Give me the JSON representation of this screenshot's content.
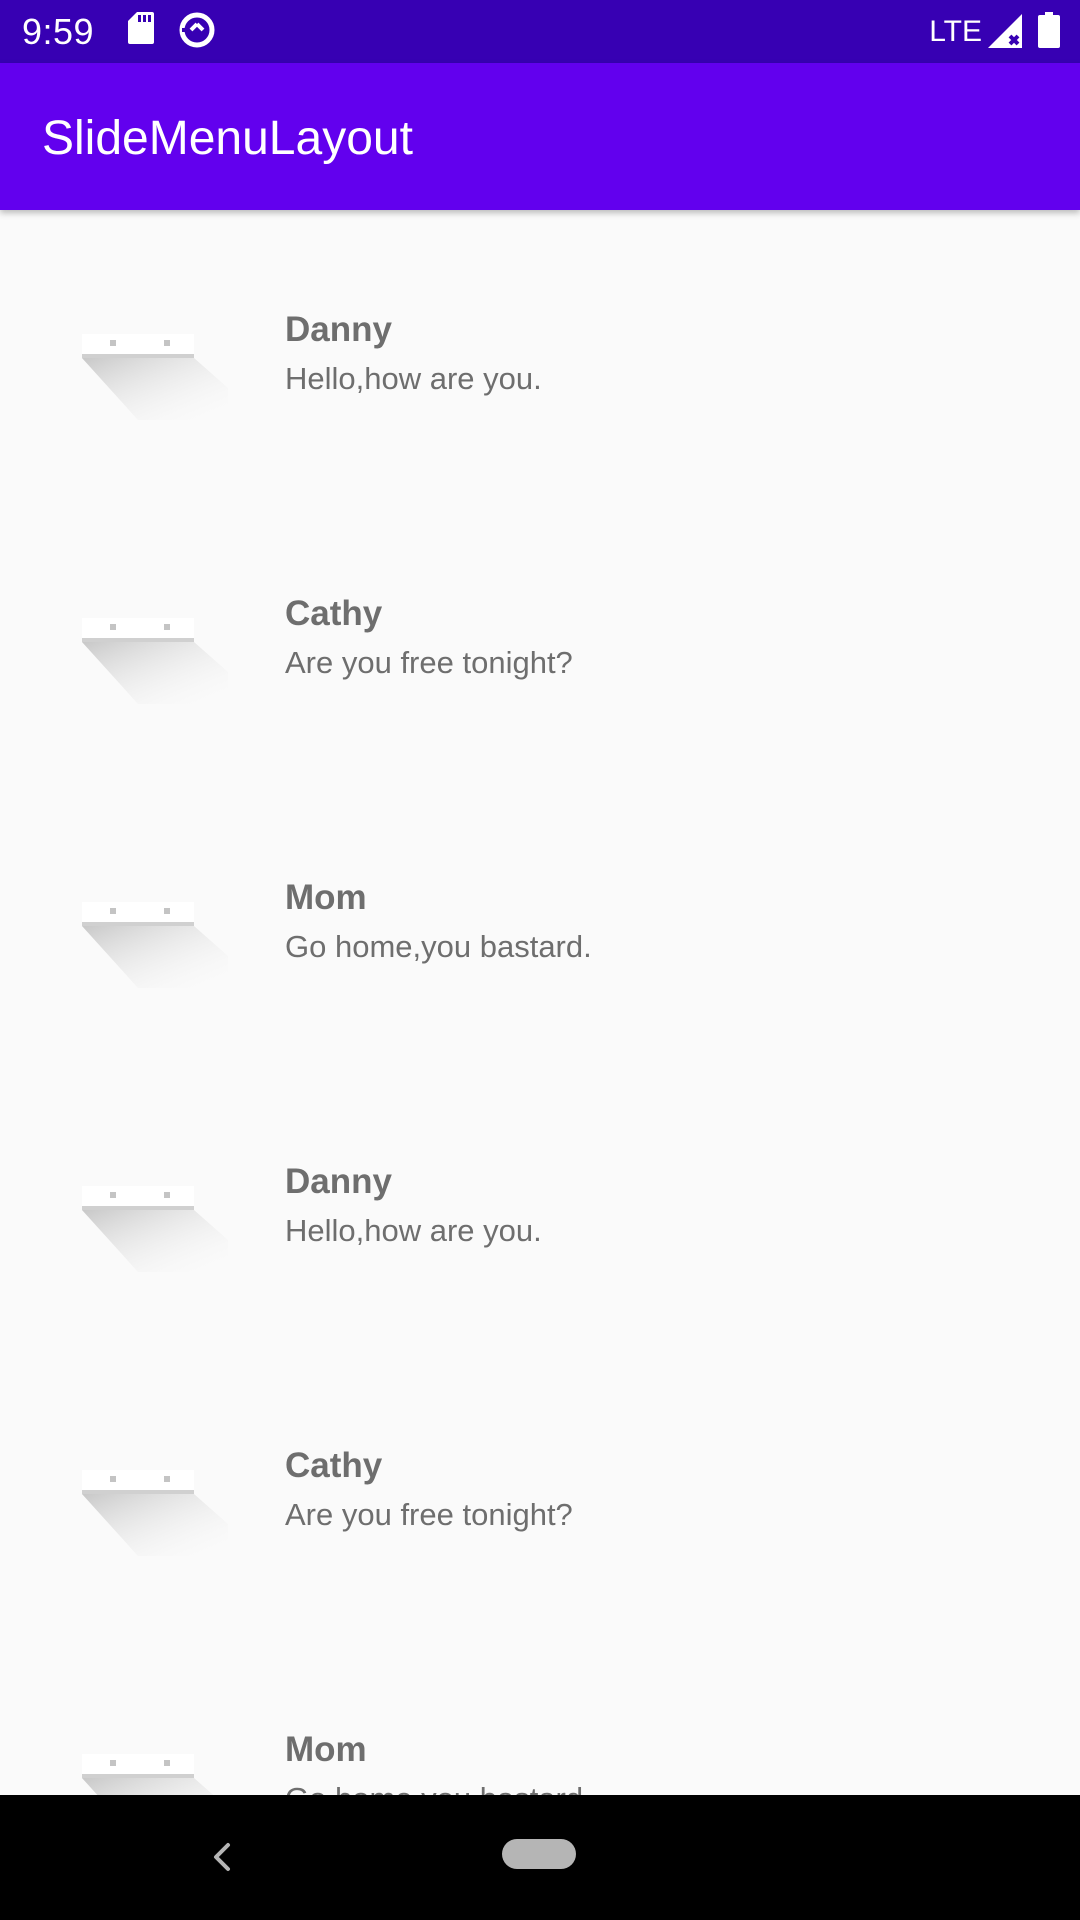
{
  "status_bar": {
    "time": "9:59",
    "network": "LTE",
    "icons": [
      "sd-card-icon",
      "data-saver-icon",
      "signal-icon",
      "battery-icon"
    ],
    "background": "#3700b3"
  },
  "app_bar": {
    "title": "SlideMenuLayout",
    "background": "#6200ee"
  },
  "list": {
    "items": [
      {
        "name": "Danny",
        "message": "Hello,how are you."
      },
      {
        "name": "Cathy",
        "message": "Are you free tonight?"
      },
      {
        "name": "Mom",
        "message": "Go home,you bastard."
      },
      {
        "name": "Danny",
        "message": "Hello,how are you."
      },
      {
        "name": "Cathy",
        "message": "Are you free tonight?"
      },
      {
        "name": "Mom",
        "message": "Go home,you bastard."
      }
    ],
    "avatar_icon": "avatar-placeholder-icon",
    "text_color": "#6e6e6e"
  },
  "nav_bar": {
    "icons": [
      "back-icon",
      "home-pill-icon"
    ]
  }
}
